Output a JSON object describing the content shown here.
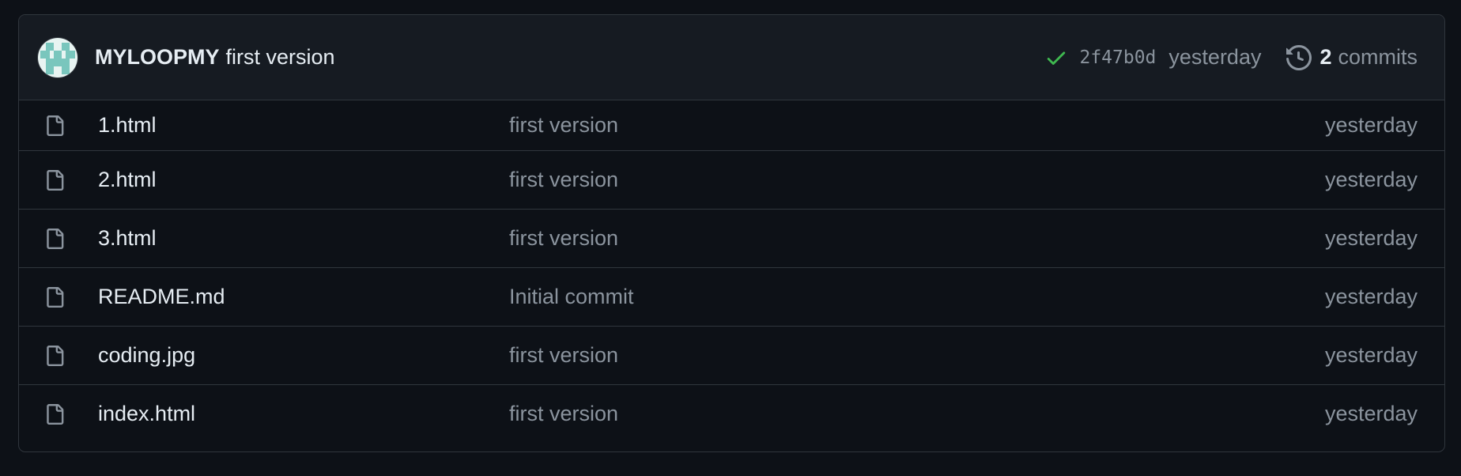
{
  "latest_commit": {
    "author": "MYLOOPMY",
    "message": "first version",
    "sha": "2f47b0d",
    "time": "yesterday",
    "commits_count": "2",
    "commits_label": "commits",
    "status": "success",
    "colors": {
      "check": "#3fb950",
      "avatar": "#79c6bd"
    }
  },
  "files": [
    {
      "name": "1.html",
      "message": "first version",
      "time": "yesterday",
      "icon": "file-icon"
    },
    {
      "name": "2.html",
      "message": "first version",
      "time": "yesterday",
      "icon": "file-icon"
    },
    {
      "name": "3.html",
      "message": "first version",
      "time": "yesterday",
      "icon": "file-icon"
    },
    {
      "name": "README.md",
      "message": "Initial commit",
      "time": "yesterday",
      "icon": "file-icon"
    },
    {
      "name": "coding.jpg",
      "message": "first version",
      "time": "yesterday",
      "icon": "file-icon"
    },
    {
      "name": "index.html",
      "message": "first version",
      "time": "yesterday",
      "icon": "file-icon"
    }
  ]
}
